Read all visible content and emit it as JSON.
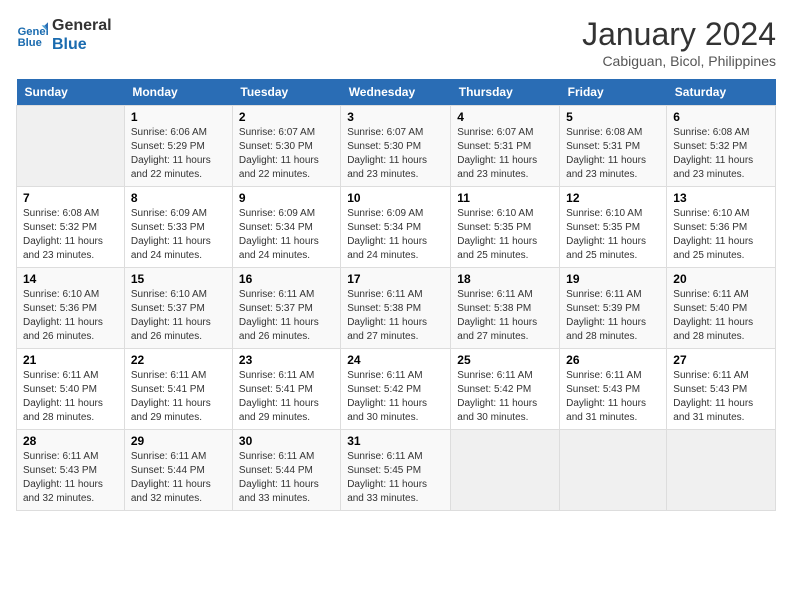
{
  "header": {
    "logo_line1": "General",
    "logo_line2": "Blue",
    "month": "January 2024",
    "location": "Cabiguan, Bicol, Philippines"
  },
  "days_of_week": [
    "Sunday",
    "Monday",
    "Tuesday",
    "Wednesday",
    "Thursday",
    "Friday",
    "Saturday"
  ],
  "weeks": [
    [
      {
        "num": "",
        "info": ""
      },
      {
        "num": "1",
        "info": "Sunrise: 6:06 AM\nSunset: 5:29 PM\nDaylight: 11 hours\nand 22 minutes."
      },
      {
        "num": "2",
        "info": "Sunrise: 6:07 AM\nSunset: 5:30 PM\nDaylight: 11 hours\nand 22 minutes."
      },
      {
        "num": "3",
        "info": "Sunrise: 6:07 AM\nSunset: 5:30 PM\nDaylight: 11 hours\nand 23 minutes."
      },
      {
        "num": "4",
        "info": "Sunrise: 6:07 AM\nSunset: 5:31 PM\nDaylight: 11 hours\nand 23 minutes."
      },
      {
        "num": "5",
        "info": "Sunrise: 6:08 AM\nSunset: 5:31 PM\nDaylight: 11 hours\nand 23 minutes."
      },
      {
        "num": "6",
        "info": "Sunrise: 6:08 AM\nSunset: 5:32 PM\nDaylight: 11 hours\nand 23 minutes."
      }
    ],
    [
      {
        "num": "7",
        "info": "Sunrise: 6:08 AM\nSunset: 5:32 PM\nDaylight: 11 hours\nand 23 minutes."
      },
      {
        "num": "8",
        "info": "Sunrise: 6:09 AM\nSunset: 5:33 PM\nDaylight: 11 hours\nand 24 minutes."
      },
      {
        "num": "9",
        "info": "Sunrise: 6:09 AM\nSunset: 5:34 PM\nDaylight: 11 hours\nand 24 minutes."
      },
      {
        "num": "10",
        "info": "Sunrise: 6:09 AM\nSunset: 5:34 PM\nDaylight: 11 hours\nand 24 minutes."
      },
      {
        "num": "11",
        "info": "Sunrise: 6:10 AM\nSunset: 5:35 PM\nDaylight: 11 hours\nand 25 minutes."
      },
      {
        "num": "12",
        "info": "Sunrise: 6:10 AM\nSunset: 5:35 PM\nDaylight: 11 hours\nand 25 minutes."
      },
      {
        "num": "13",
        "info": "Sunrise: 6:10 AM\nSunset: 5:36 PM\nDaylight: 11 hours\nand 25 minutes."
      }
    ],
    [
      {
        "num": "14",
        "info": "Sunrise: 6:10 AM\nSunset: 5:36 PM\nDaylight: 11 hours\nand 26 minutes."
      },
      {
        "num": "15",
        "info": "Sunrise: 6:10 AM\nSunset: 5:37 PM\nDaylight: 11 hours\nand 26 minutes."
      },
      {
        "num": "16",
        "info": "Sunrise: 6:11 AM\nSunset: 5:37 PM\nDaylight: 11 hours\nand 26 minutes."
      },
      {
        "num": "17",
        "info": "Sunrise: 6:11 AM\nSunset: 5:38 PM\nDaylight: 11 hours\nand 27 minutes."
      },
      {
        "num": "18",
        "info": "Sunrise: 6:11 AM\nSunset: 5:38 PM\nDaylight: 11 hours\nand 27 minutes."
      },
      {
        "num": "19",
        "info": "Sunrise: 6:11 AM\nSunset: 5:39 PM\nDaylight: 11 hours\nand 28 minutes."
      },
      {
        "num": "20",
        "info": "Sunrise: 6:11 AM\nSunset: 5:40 PM\nDaylight: 11 hours\nand 28 minutes."
      }
    ],
    [
      {
        "num": "21",
        "info": "Sunrise: 6:11 AM\nSunset: 5:40 PM\nDaylight: 11 hours\nand 28 minutes."
      },
      {
        "num": "22",
        "info": "Sunrise: 6:11 AM\nSunset: 5:41 PM\nDaylight: 11 hours\nand 29 minutes."
      },
      {
        "num": "23",
        "info": "Sunrise: 6:11 AM\nSunset: 5:41 PM\nDaylight: 11 hours\nand 29 minutes."
      },
      {
        "num": "24",
        "info": "Sunrise: 6:11 AM\nSunset: 5:42 PM\nDaylight: 11 hours\nand 30 minutes."
      },
      {
        "num": "25",
        "info": "Sunrise: 6:11 AM\nSunset: 5:42 PM\nDaylight: 11 hours\nand 30 minutes."
      },
      {
        "num": "26",
        "info": "Sunrise: 6:11 AM\nSunset: 5:43 PM\nDaylight: 11 hours\nand 31 minutes."
      },
      {
        "num": "27",
        "info": "Sunrise: 6:11 AM\nSunset: 5:43 PM\nDaylight: 11 hours\nand 31 minutes."
      }
    ],
    [
      {
        "num": "28",
        "info": "Sunrise: 6:11 AM\nSunset: 5:43 PM\nDaylight: 11 hours\nand 32 minutes."
      },
      {
        "num": "29",
        "info": "Sunrise: 6:11 AM\nSunset: 5:44 PM\nDaylight: 11 hours\nand 32 minutes."
      },
      {
        "num": "30",
        "info": "Sunrise: 6:11 AM\nSunset: 5:44 PM\nDaylight: 11 hours\nand 33 minutes."
      },
      {
        "num": "31",
        "info": "Sunrise: 6:11 AM\nSunset: 5:45 PM\nDaylight: 11 hours\nand 33 minutes."
      },
      {
        "num": "",
        "info": ""
      },
      {
        "num": "",
        "info": ""
      },
      {
        "num": "",
        "info": ""
      }
    ]
  ]
}
